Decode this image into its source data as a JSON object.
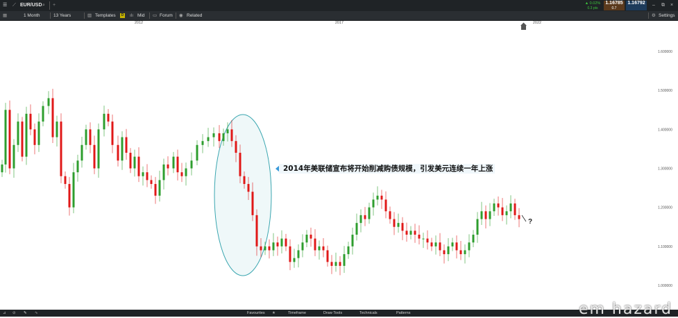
{
  "topbar": {
    "symbol": "EUR/USD",
    "change_pct": "▲ 0.02%",
    "change_sub": "0.3 pts",
    "bid": "1.16785",
    "ask": "1.16792",
    "spread": "0.7"
  },
  "toolbar": {
    "interval": "1 Month",
    "range": "13 Years",
    "templates": "Templates",
    "mid_badge": "D",
    "mid": "Mid",
    "forum": "Forum",
    "related": "Related",
    "settings": "Settings"
  },
  "chart_data": {
    "type": "candlestick",
    "x_ticks": [
      "2012",
      "2017",
      "2022"
    ],
    "y_ticks": [
      "1.600000",
      "1.500000",
      "1.400000",
      "1.300000",
      "1.200000",
      "1.100000",
      "1.000000"
    ],
    "ylim": [
      0.98,
      1.655
    ],
    "annotation": "2014年美联储宣布将开始削减购债规模，引发美元连续一年上涨",
    "question_mark": "?",
    "colors": {
      "up": "#2e9e2e",
      "down": "#e01818",
      "ellipse_stroke": "#3aa6b0",
      "ellipse_fill": "#e8f5f6"
    }
  },
  "bottombar": {
    "favourites": "Favourites",
    "timeframe": "Timeframe",
    "draw_tools": "Draw Tools",
    "technicals": "Technicals",
    "patterns": "Patterns"
  },
  "watermark": "em hazard"
}
